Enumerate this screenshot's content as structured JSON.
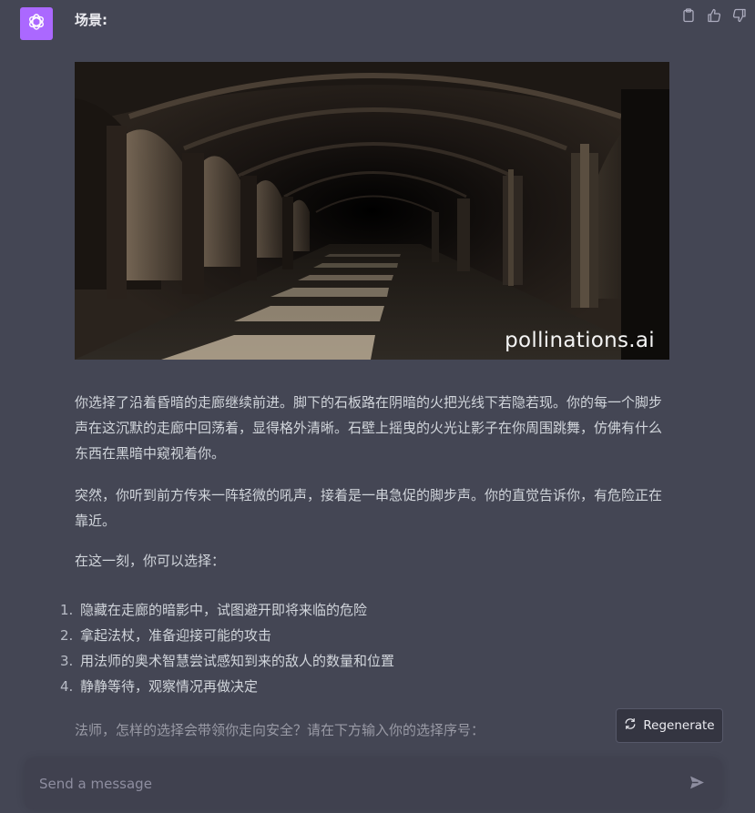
{
  "author": "场景:",
  "icons": {
    "avatar": "openai-logo-icon",
    "copy": "clipboard-icon",
    "like": "thumbs-up-icon",
    "dislike": "thumbs-down-icon",
    "regenerate": "refresh-icon",
    "send": "paper-plane-icon"
  },
  "image": {
    "watermark": "pollinations.ai"
  },
  "paragraphs": [
    "你选择了沿着昏暗的走廊继续前进。脚下的石板路在阴暗的火把光线下若隐若现。你的每一个脚步声在这沉默的走廊中回荡着，显得格外清晰。石壁上摇曳的火光让影子在你周围跳舞，仿佛有什么东西在黑暗中窥视着你。",
    "突然，你听到前方传来一阵轻微的吼声，接着是一串急促的脚步声。你的直觉告诉你，有危险正在靠近。",
    "在这一刻，你可以选择："
  ],
  "options": [
    {
      "num": "1.",
      "text": "隐藏在走廊的暗影中，试图避开即将来临的危险"
    },
    {
      "num": "2.",
      "text": "拿起法杖，准备迎接可能的攻击"
    },
    {
      "num": "3.",
      "text": "用法师的奥术智慧尝试感知到来的敌人的数量和位置"
    },
    {
      "num": "4.",
      "text": "静静等待，观察情况再做决定"
    }
  ],
  "closing": "法师，怎样的选择会带领你走向安全？请在下方输入你的选择序号：",
  "regenerate_label": "Regenerate",
  "composer": {
    "placeholder": "Send a message",
    "value": ""
  },
  "colors": {
    "background": "#444654",
    "avatar": "#ab68ff",
    "composer": "#40414f"
  }
}
